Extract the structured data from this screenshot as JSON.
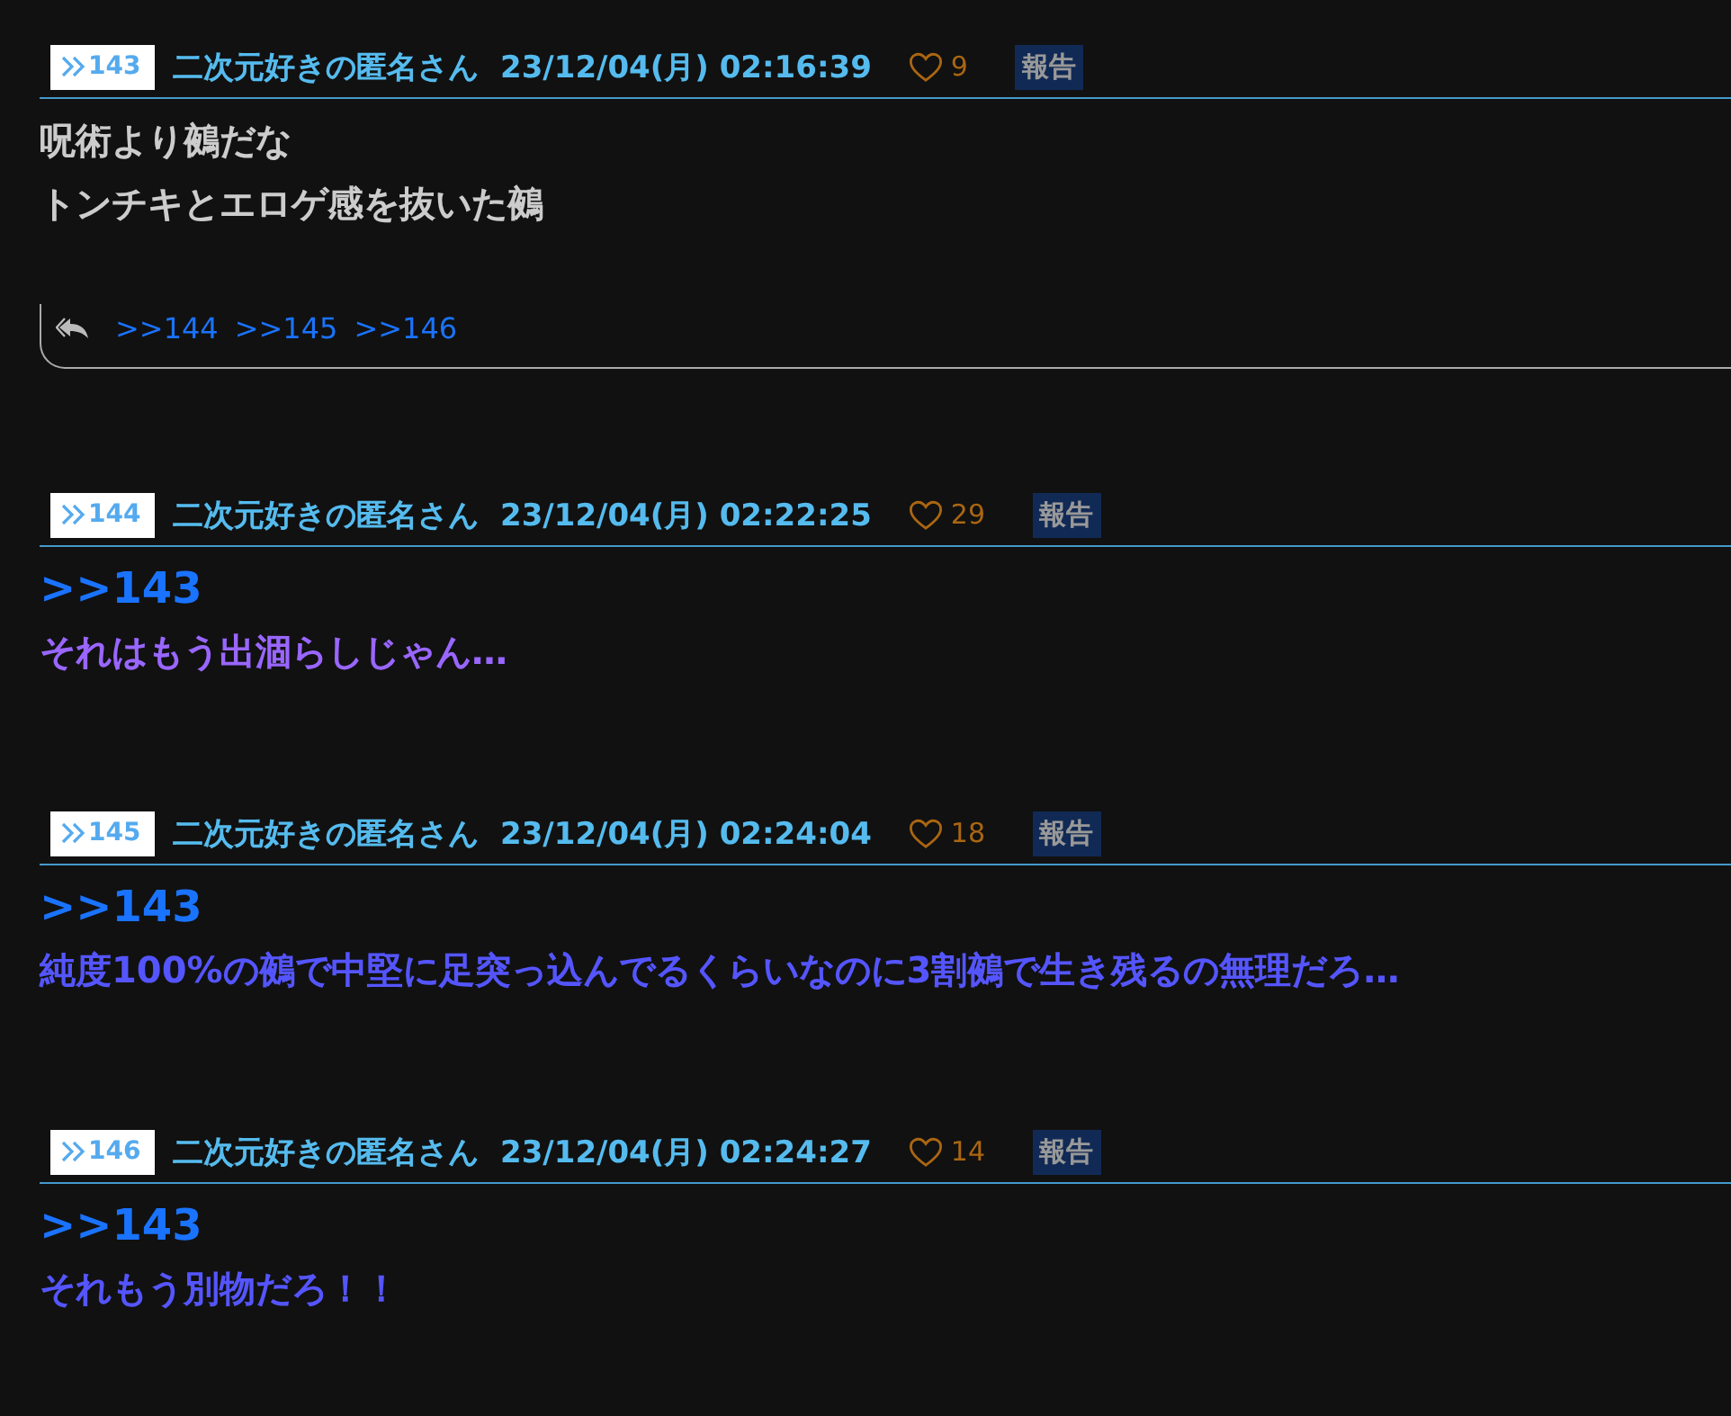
{
  "posts": [
    {
      "number": "143",
      "name": "二次元好きの匿名さん",
      "date": "23/12/04(月) 02:16:39",
      "likes": "9",
      "report": "報告",
      "lines": [
        {
          "kind": "text",
          "text": "呪術より鵺だな",
          "color": "#cccccc"
        },
        {
          "kind": "text",
          "text": "トンチキとエロゲ感を抜いた鵺",
          "color": "#cccccc"
        }
      ],
      "replies": [
        ">>144",
        ">>145",
        ">>146"
      ]
    },
    {
      "number": "144",
      "name": "二次元好きの匿名さん",
      "date": "23/12/04(月) 02:22:25",
      "likes": "29",
      "report": "報告",
      "lines": [
        {
          "kind": "anchor",
          "text": ">>143"
        },
        {
          "kind": "text",
          "text": "それはもう出涸らしじゃん…",
          "color": "#9966ff"
        }
      ]
    },
    {
      "number": "145",
      "name": "二次元好きの匿名さん",
      "date": "23/12/04(月) 02:24:04",
      "likes": "18",
      "report": "報告",
      "lines": [
        {
          "kind": "anchor",
          "text": ">>143"
        },
        {
          "kind": "text",
          "text": "純度100%の鵺で中堅に足突っ込んでるくらいなのに3割鵺で生き残るの無理だろ…",
          "color": "#5555ff"
        }
      ]
    },
    {
      "number": "146",
      "name": "二次元好きの匿名さん",
      "date": "23/12/04(月) 02:24:27",
      "likes": "14",
      "report": "報告",
      "lines": [
        {
          "kind": "anchor",
          "text": ">>143"
        },
        {
          "kind": "text",
          "text": "それもう別物だろ！！",
          "color": "#5555ff"
        }
      ]
    }
  ]
}
